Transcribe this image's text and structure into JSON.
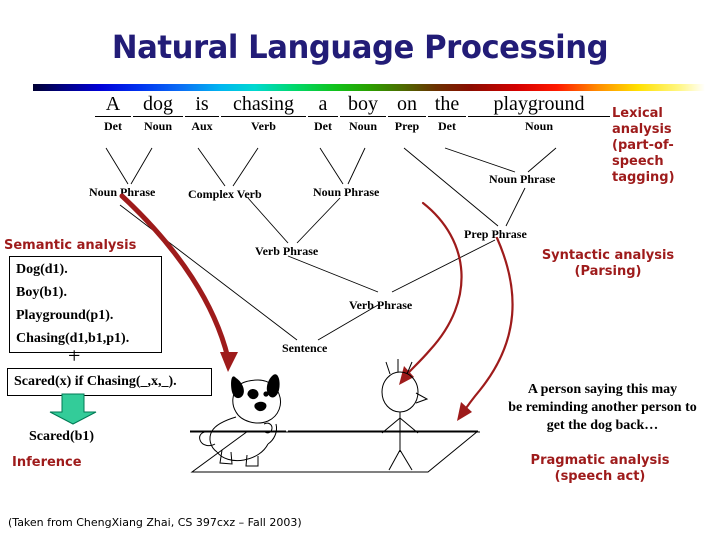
{
  "slide": {
    "title": "Natural Language Processing",
    "credit": "(Taken from ChengXiang Zhai, CS 397cxz – Fall 2003)",
    "accent_red": "#9e1b1b",
    "title_color": "#221c77",
    "arrow_green": "#33cc99"
  },
  "sentence": {
    "tokens": [
      {
        "word": "A",
        "pos": "Det"
      },
      {
        "word": "dog",
        "pos": "Noun"
      },
      {
        "word": "is",
        "pos": "Aux"
      },
      {
        "word": "chasing",
        "pos": "Verb"
      },
      {
        "word": "a",
        "pos": "Det"
      },
      {
        "word": "boy",
        "pos": "Noun"
      },
      {
        "word": "on",
        "pos": "Prep"
      },
      {
        "word": "the",
        "pos": "Det"
      },
      {
        "word": "playground",
        "pos": "Noun"
      }
    ]
  },
  "parse_nodes": {
    "noun_phrase_1": "Noun Phrase",
    "complex_verb": "Complex Verb",
    "noun_phrase_2": "Noun Phrase",
    "noun_phrase_3": "Noun Phrase",
    "prep_phrase": "Prep Phrase",
    "verb_phrase_1": "Verb Phrase",
    "verb_phrase_2": "Verb Phrase",
    "sentence": "Sentence"
  },
  "annotations": {
    "lexical": "Lexical\nanalysis\n(part-of-speech\ntagging)",
    "lexical_l1": "Lexical",
    "lexical_l2": "analysis",
    "lexical_l3": "(part-of-speech",
    "lexical_l4": "tagging)",
    "semantic": "Semantic analysis",
    "syntactic_l1": "Syntactic analysis",
    "syntactic_l2": "(Parsing)",
    "pragmatic_l1": "Pragmatic analysis",
    "pragmatic_l2": "(speech act)",
    "inference": "Inference"
  },
  "semantics": {
    "facts": [
      "Dog(d1).",
      "Boy(b1).",
      "Playground(p1).",
      "Chasing(d1,b1,p1)."
    ],
    "plus": "+",
    "rule": "Scared(x) if Chasing(_,x,_).",
    "conclusion": "Scared(b1)"
  },
  "pragmatics": {
    "lines": [
      "A person saying this may",
      "be reminding another person to",
      "get the dog back…"
    ]
  }
}
